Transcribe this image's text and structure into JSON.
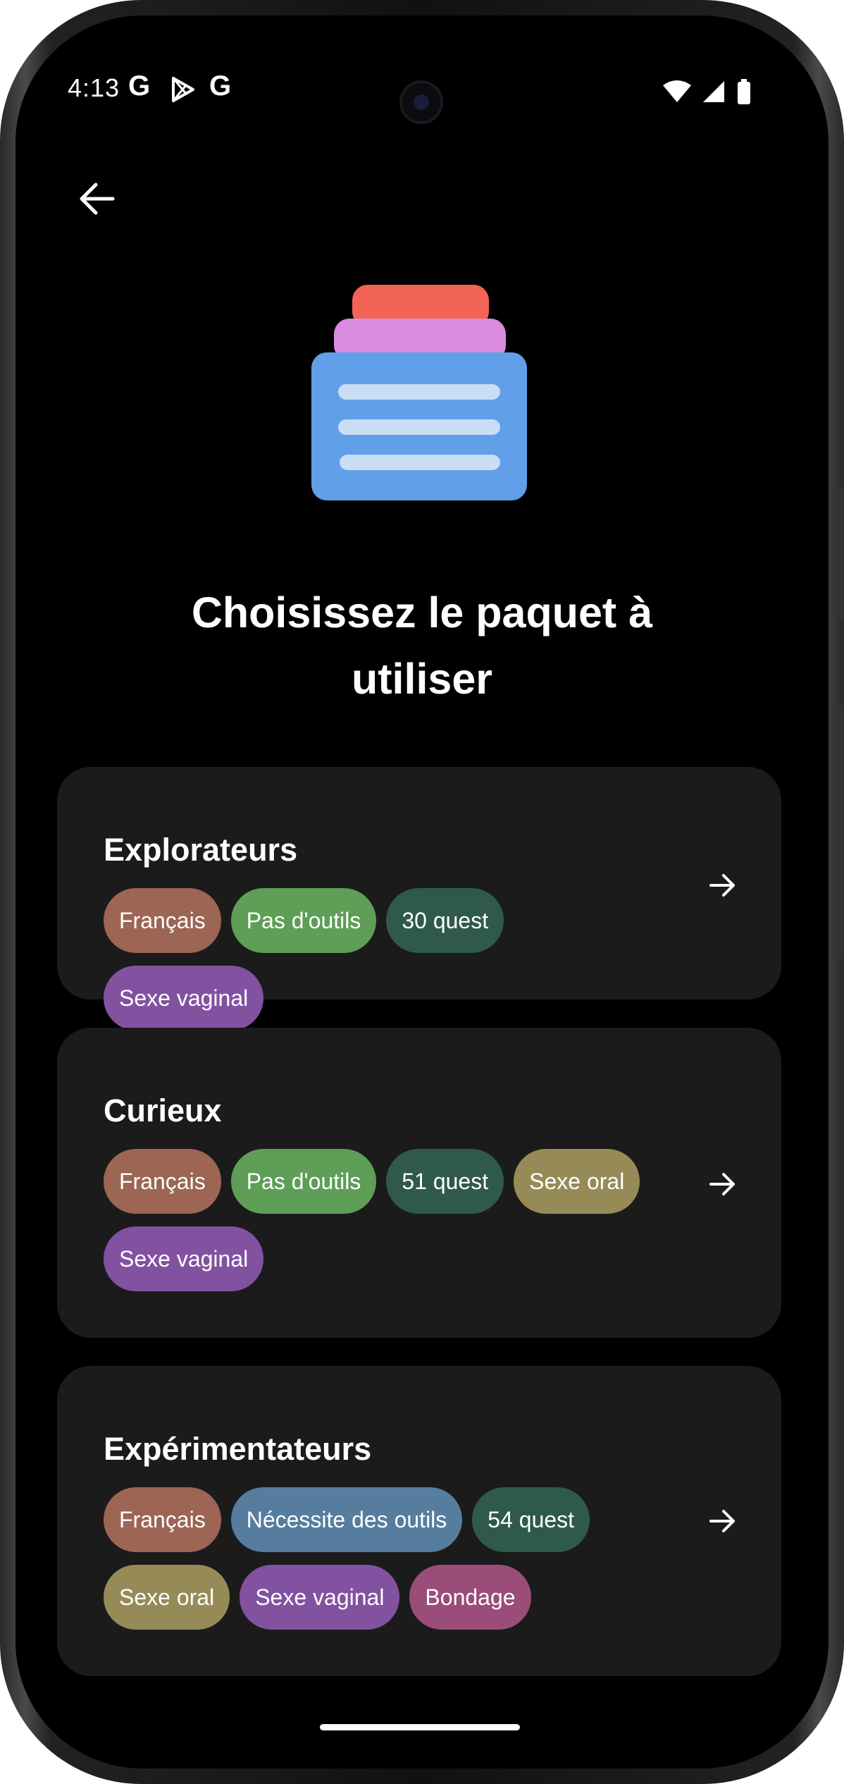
{
  "status_bar": {
    "time": "4:13",
    "left_icons": [
      "google-icon",
      "play-store-icon",
      "google-icon"
    ],
    "right_icons": [
      "wifi-icon",
      "signal-icon",
      "battery-icon"
    ]
  },
  "header": {
    "back_icon": "arrow-left-icon"
  },
  "illustration": {
    "icon": "card-deck-icon",
    "colors": {
      "top": "#F26455",
      "middle": "#D98BDF",
      "body": "#619FE8",
      "lines": "#C9DDF5"
    }
  },
  "title": "Choisissez le paquet à utiliser",
  "decks": [
    {
      "name": "Explorateurs",
      "tags": [
        {
          "label": "Français",
          "color": "#9C6554"
        },
        {
          "label": "Pas d'outils",
          "color": "#5E9E57"
        },
        {
          "label": "30 quest",
          "color": "#2F5A4A"
        },
        {
          "label": "Sexe vaginal",
          "color": "#8252A1"
        }
      ]
    },
    {
      "name": "Curieux",
      "tags": [
        {
          "label": "Français",
          "color": "#9C6554"
        },
        {
          "label": "Pas d'outils",
          "color": "#5E9E57"
        },
        {
          "label": "51 quest",
          "color": "#2F5A4A"
        },
        {
          "label": "Sexe oral",
          "color": "#968B57"
        },
        {
          "label": "Sexe vaginal",
          "color": "#8252A1"
        }
      ]
    },
    {
      "name": "Expérimentateurs",
      "tags": [
        {
          "label": "Français",
          "color": "#9C6554"
        },
        {
          "label": "Nécessite des outils",
          "color": "#567D9E"
        },
        {
          "label": "54 quest",
          "color": "#2F5A4A"
        },
        {
          "label": "Sexe oral",
          "color": "#968B57"
        },
        {
          "label": "Sexe vaginal",
          "color": "#8252A1"
        },
        {
          "label": "Bondage",
          "color": "#9A4D78"
        }
      ]
    }
  ],
  "colors": {
    "background": "#000000",
    "card": "#1B1B1B",
    "text": "#FFFFFF"
  }
}
